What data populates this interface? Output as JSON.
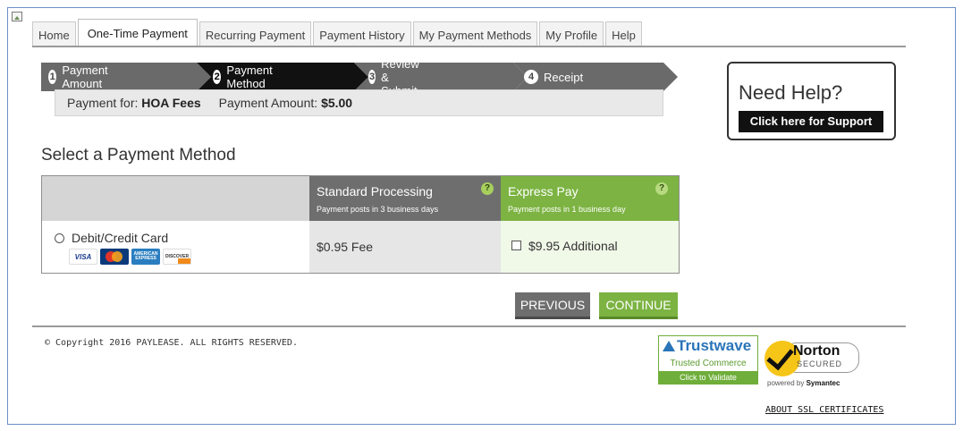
{
  "tabs": [
    {
      "label": "Home",
      "active": false
    },
    {
      "label": "One-Time Payment",
      "active": true
    },
    {
      "label": "Recurring Payment",
      "active": false
    },
    {
      "label": "Payment History",
      "active": false
    },
    {
      "label": "My Payment Methods",
      "active": false
    },
    {
      "label": "My Profile",
      "active": false
    },
    {
      "label": "Help",
      "active": false
    }
  ],
  "steps": [
    {
      "num": "1",
      "label": "Payment Amount"
    },
    {
      "num": "2",
      "label": "Payment Method"
    },
    {
      "num": "3",
      "label": "Review & Submit"
    },
    {
      "num": "4",
      "label": "Receipt"
    }
  ],
  "payment_info": {
    "for_label": "Payment for:",
    "for_value": "HOA Fees",
    "amount_label": "Payment Amount:",
    "amount_value": "$5.00"
  },
  "help": {
    "title": "Need Help?",
    "button": "Click here for Support"
  },
  "section_title": "Select a Payment Method",
  "table": {
    "standard": {
      "title": "Standard Processing",
      "subtitle": "Payment posts in 3 business days",
      "fee": "$0.95 Fee"
    },
    "express": {
      "title": "Express Pay",
      "subtitle": "Payment posts in 1 business day",
      "fee": "$9.95 Additional"
    },
    "method_label": "Debit/Credit Card",
    "help_mark": "?",
    "cards": [
      "VISA",
      "MasterCard",
      "AMERICAN EXPRESS",
      "DISCOVER"
    ]
  },
  "buttons": {
    "previous": "PREVIOUS",
    "continue": "CONTINUE"
  },
  "footer": {
    "copyright": "© Copyright 2016 PAYLEASE. ALL RIGHTS RESERVED.",
    "ssl_link": "ABOUT SSL CERTIFICATES"
  },
  "badges": {
    "trustwave_name": "Trustwave",
    "trustwave_sub": "Trusted Commerce",
    "trustwave_click": "Click to Validate",
    "norton_name": "Norton",
    "norton_secured": "SECURED",
    "norton_powered": "powered by",
    "norton_symantec": "Symantec"
  },
  "colors": {
    "green": "#7cb342",
    "dark_gray": "#6e6e6e",
    "step_active": "#111111",
    "step_inactive": "#6a6a6a"
  }
}
